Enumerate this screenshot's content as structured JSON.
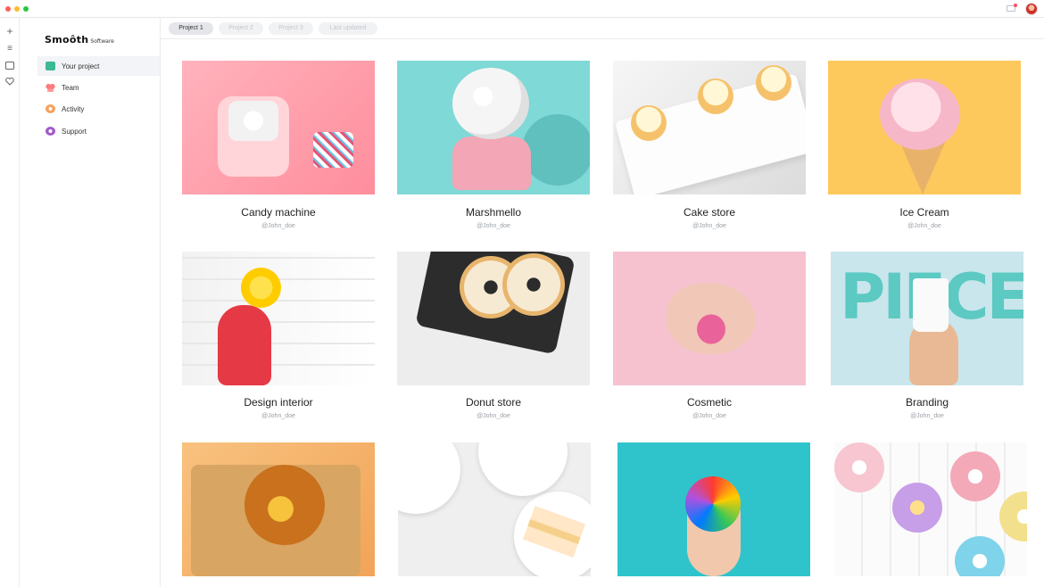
{
  "window": {
    "title_bar_icons": [
      "close-dot",
      "minimize-dot",
      "maximize-dot",
      "mail-icon",
      "avatar"
    ]
  },
  "rail": {
    "icons": [
      "plus-icon",
      "menu-icon",
      "window-icon",
      "heart-icon"
    ]
  },
  "sidebar": {
    "logo": "Smoôth",
    "logo_sub": "Software",
    "items": [
      {
        "label": "Your project",
        "icon": "briefcase-icon",
        "active": true
      },
      {
        "label": "Team",
        "icon": "team-icon",
        "active": false
      },
      {
        "label": "Activity",
        "icon": "activity-icon",
        "active": false
      },
      {
        "label": "Support",
        "icon": "support-icon",
        "active": false
      }
    ]
  },
  "tabs": [
    {
      "label": "Project 1",
      "active": true
    },
    {
      "label": "Project 2",
      "active": false
    },
    {
      "label": "Project 3",
      "active": false
    },
    {
      "label": "Last updated",
      "active": false
    }
  ],
  "cards": [
    {
      "title": "Candy machine",
      "user": "@John_doe"
    },
    {
      "title": "Marshmello",
      "user": "@John_doe"
    },
    {
      "title": "Cake store",
      "user": "@John_doe"
    },
    {
      "title": "Ice Cream",
      "user": "@John_doe"
    },
    {
      "title": "Design interior",
      "user": "@John_doe"
    },
    {
      "title": "Donut store",
      "user": "@John_doe"
    },
    {
      "title": "Cosmetic",
      "user": "@John_doe"
    },
    {
      "title": "Branding",
      "user": "@John_doe"
    },
    {
      "title": "",
      "user": ""
    },
    {
      "title": "",
      "user": ""
    },
    {
      "title": "",
      "user": ""
    },
    {
      "title": "",
      "user": ""
    }
  ],
  "colors": {
    "active_tab_bg": "#e4e6ea",
    "tab_bg": "#f1f2f4",
    "sidebar_active_bg": "#f3f4f7"
  }
}
